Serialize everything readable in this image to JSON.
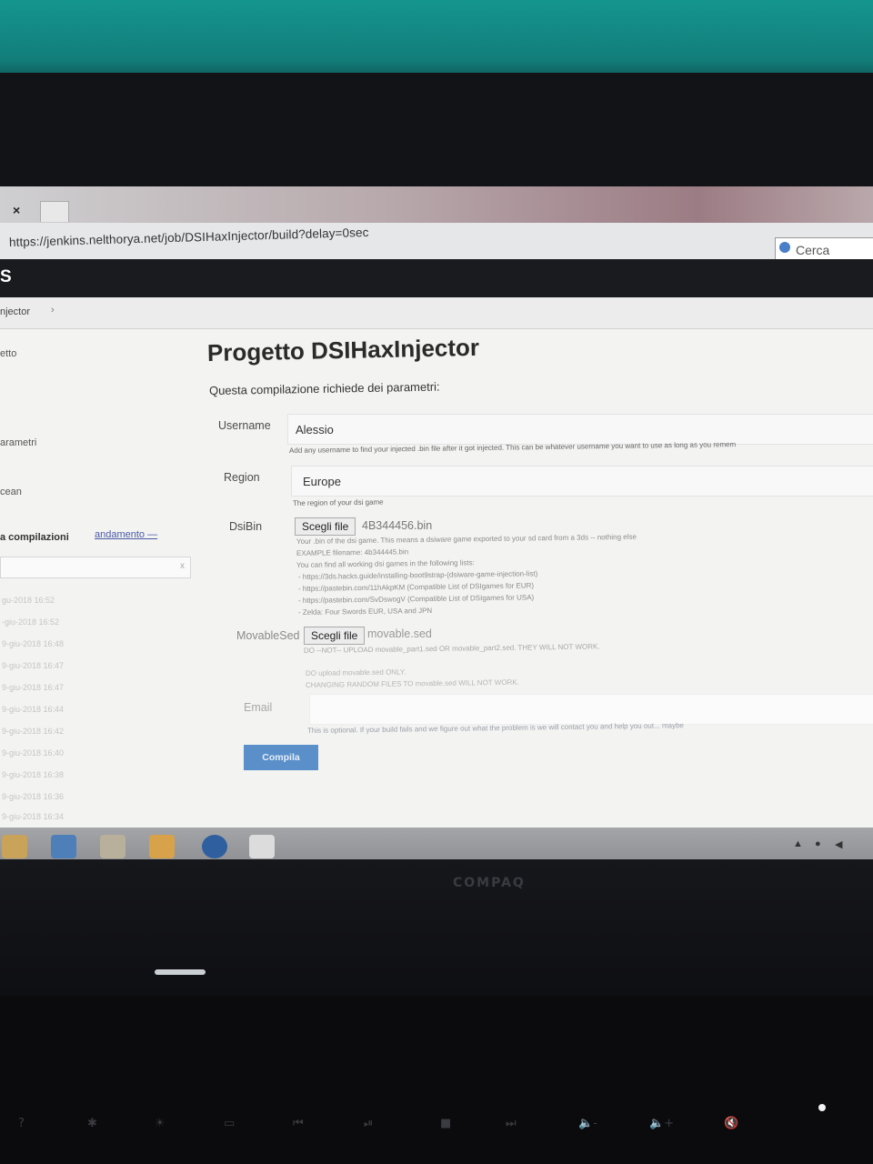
{
  "browser": {
    "url": "https://jenkins.nelthorya.net/job/DSIHaxInjector/build?delay=0sec",
    "search_placeholder": "Cerca",
    "tab_close": "×"
  },
  "header": {
    "logo": "S"
  },
  "breadcrumb": {
    "item": "njector",
    "arrow": "›"
  },
  "sidebar": {
    "items": [
      "etto",
      "arametri",
      "cean"
    ],
    "history_title": "a compilazioni",
    "trend_link": "andamento —",
    "filter_clear": "x",
    "history": [
      "gu-2018 16:52",
      "-giu-2018 16:52",
      "9-giu-2018 16:48",
      "9-giu-2018 16:47",
      "9-giu-2018 16:47",
      "9-giu-2018 16:44",
      "9-giu-2018 16:42",
      "9-giu-2018 16:40",
      "9-giu-2018 16:38",
      "9-giu-2018 16:36",
      "9-giu-2018 16:34"
    ]
  },
  "main": {
    "title": "Progetto DSIHaxInjector",
    "subtitle": "Questa compilazione richiede dei parametri:",
    "username": {
      "label": "Username",
      "value": "Alessio",
      "description": "Add any username to find your injected .bin file after it got injected. This can be whatever username you want to use as long as you remem"
    },
    "region": {
      "label": "Region",
      "value": "Europe",
      "description": "The region of your dsi game"
    },
    "dsibin": {
      "label": "DsiBin",
      "button": "Scegli file",
      "filename": "4B344456.bin",
      "help": [
        "Your .bin of the dsi game. This means a dsiware game exported to your sd card from a 3ds -- nothing else",
        "EXAMPLE filename: 4b344445.bin",
        "You can find all working dsi games in the following lists:",
        "- https://3ds.hacks.guide/installing-boot9strap-(dsiware-game-injection-list)",
        "- https://pastebin.com/11hAkpKM (Compatible List of DSIgames for EUR)",
        "- https://pastebin.com/SvDswogV (Compatible List of DSIgames for USA)",
        "- Zelda: Four Swords EUR, USA and JPN"
      ]
    },
    "movablesed": {
      "label": "MovableSed",
      "button": "Scegli file",
      "filename": "movable.sed",
      "help": [
        "DO --NOT-- UPLOAD movable_part1.sed OR movable_part2.sed. THEY WILL NOT WORK.",
        "DO upload movable.sed ONLY.",
        "CHANGING RANDOM FILES TO movable.sed WILL NOT WORK."
      ]
    },
    "email": {
      "label": "Email",
      "description": "This is optional. If your build fails and we figure out what the problem is we will contact you and help you out... maybe"
    },
    "submit": "Compila"
  },
  "hardware": {
    "brand": "COMPAQ",
    "keys": [
      "?",
      "✱",
      "☀",
      "▭",
      "⏮",
      "⏯",
      "■",
      "⏭",
      "🔈-",
      "🔈+",
      "🔇"
    ]
  },
  "colors": {
    "submit_button": "#5a8fc9",
    "jenkins_header": "#191b1f",
    "link": "#4a5aa6"
  }
}
